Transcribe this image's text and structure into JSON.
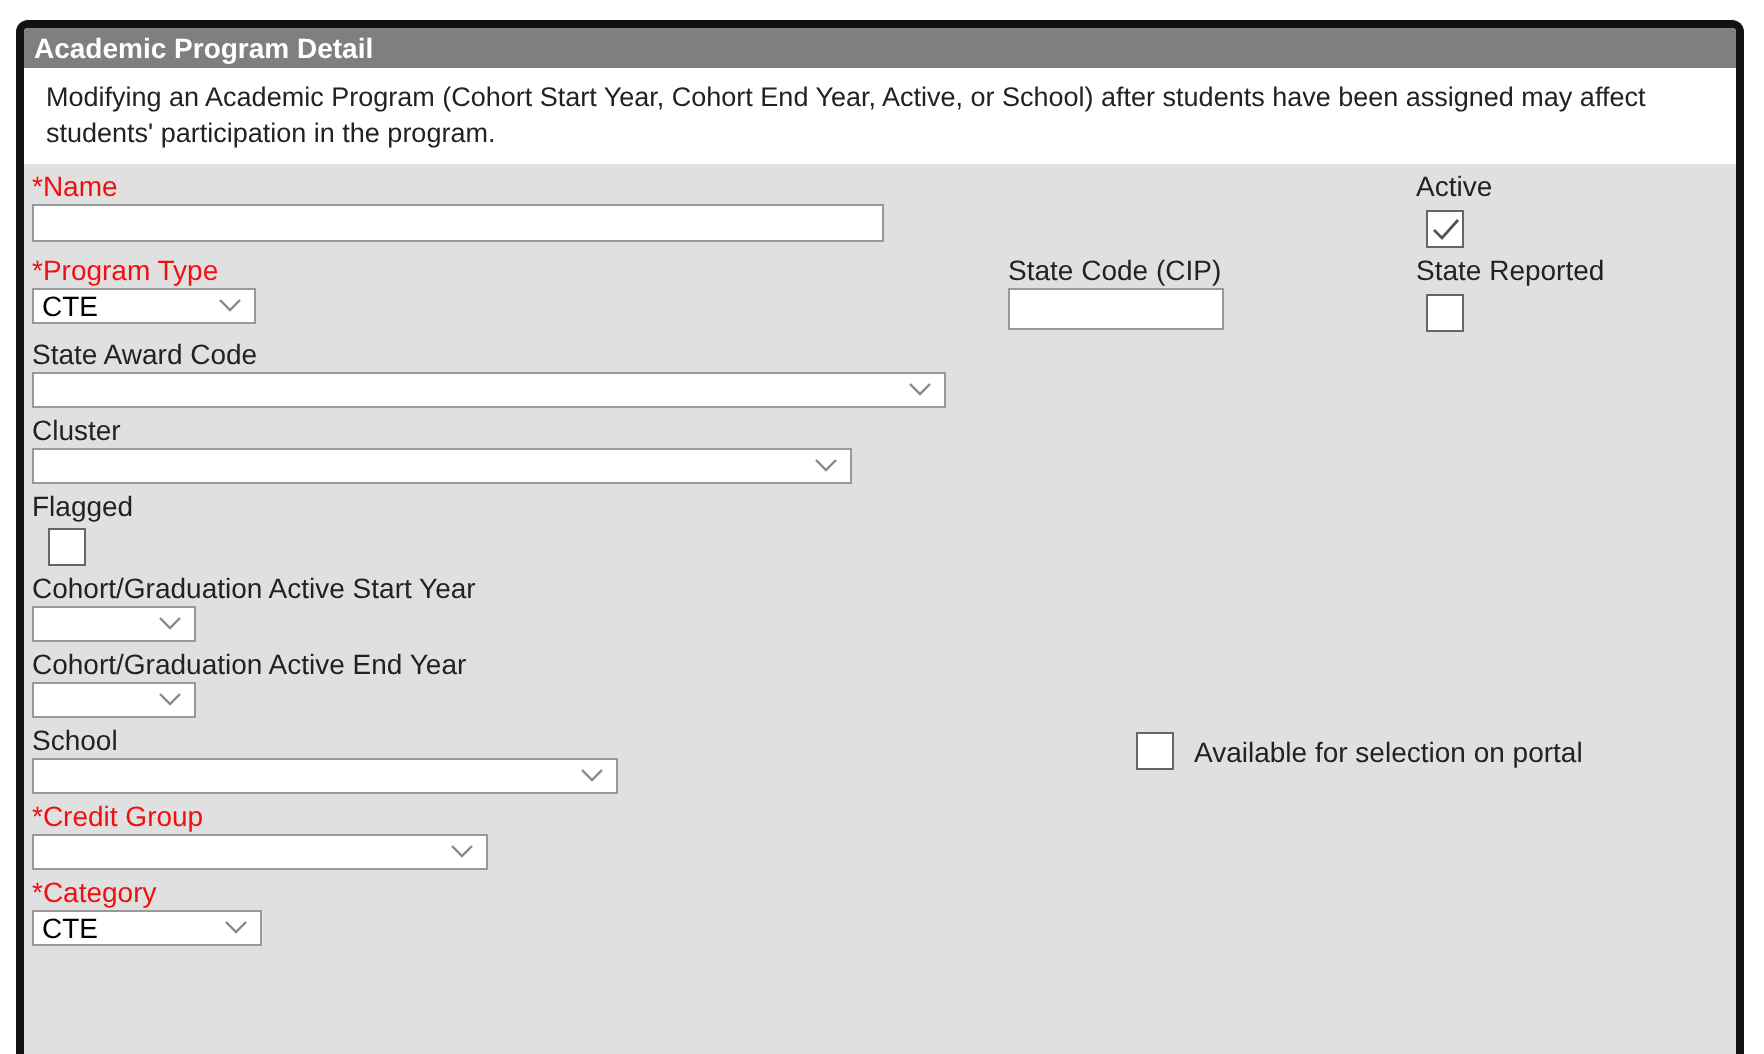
{
  "panel": {
    "title": "Academic Program Detail",
    "notice": "Modifying an Academic Program (Cohort Start Year, Cohort End Year, Active, or School) after students have been assigned may affect students' participation in the program."
  },
  "fields": [
    {
      "kind": "text",
      "label": "*Name",
      "required": true
    },
    {
      "kind": "select",
      "label": "*Program Type",
      "required": true,
      "value": "CTE"
    },
    {
      "kind": "select",
      "label": "State Award Code",
      "required": false
    },
    {
      "kind": "select",
      "label": "Cluster",
      "required": false
    },
    {
      "kind": "checkbox",
      "label": "Flagged",
      "required": false,
      "checked": false
    },
    {
      "kind": "select",
      "label": "Cohort/Graduation Active Start Year",
      "required": false
    },
    {
      "kind": "select",
      "label": "Cohort/Graduation Active End Year",
      "required": false
    },
    {
      "kind": "select",
      "label": "School",
      "required": false
    },
    {
      "kind": "select",
      "label": "*Credit Group",
      "required": true
    },
    {
      "kind": "select",
      "label": "*Category",
      "required": true,
      "value": "CTE"
    }
  ],
  "active": {
    "label": "Active",
    "checked": true
  },
  "state_code": {
    "label": "State Code (CIP)"
  },
  "state_reported": {
    "label": "State Reported",
    "checked": false
  },
  "portal": {
    "label": "Available for selection on portal",
    "checked": false
  }
}
